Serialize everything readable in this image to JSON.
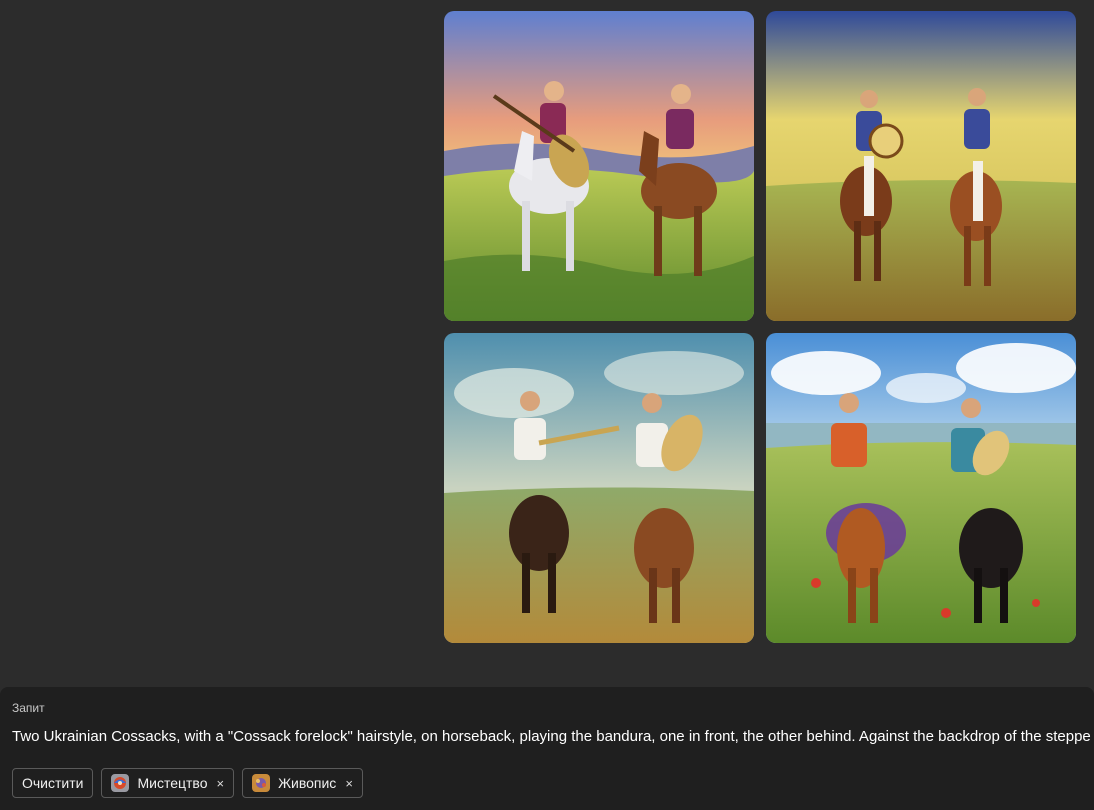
{
  "gallery": {
    "images": [
      {
        "name": "generated-image-1",
        "palette": [
          "#6f8fd8",
          "#f3c56b",
          "#a8c24a",
          "#6d8b2e"
        ]
      },
      {
        "name": "generated-image-2",
        "palette": [
          "#3d57a6",
          "#e7d46a",
          "#9bb34a",
          "#8a7a2c"
        ]
      },
      {
        "name": "generated-image-3",
        "palette": [
          "#6fa0b8",
          "#c9d3b6",
          "#8ea65c",
          "#6d7e38"
        ]
      },
      {
        "name": "generated-image-4",
        "palette": [
          "#5a9bd8",
          "#e8f0f5",
          "#9fb84a",
          "#6a8f2a"
        ]
      }
    ]
  },
  "prompt": {
    "heading": "Запит",
    "text": "Two Ukrainian Cossacks, with a \"Cossack forelock\" hairstyle, on horseback, playing the bandura, one in front, the other behind. Against the backdrop of the steppe"
  },
  "chips": {
    "clear_label": "Очистити",
    "tags": [
      {
        "label": "Мистецтво",
        "icon": "art-style-thumbnail-icon",
        "close": "×"
      },
      {
        "label": "Живопис",
        "icon": "painting-style-thumbnail-icon",
        "close": "×"
      }
    ]
  }
}
